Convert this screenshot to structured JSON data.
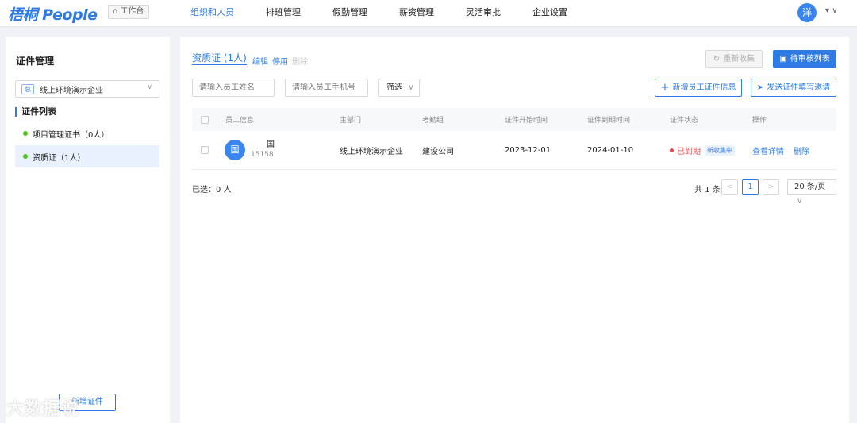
{
  "app": {
    "logo": "梧桐 People",
    "workbench": "工作台",
    "user_initial": "洋",
    "user_caret": "▾ ∨"
  },
  "nav": {
    "items": [
      {
        "label": "组织和人员",
        "active": true
      },
      {
        "label": "排班管理"
      },
      {
        "label": "假勤管理"
      },
      {
        "label": "薪资管理"
      },
      {
        "label": "灵活审批"
      },
      {
        "label": "企业设置"
      }
    ]
  },
  "sidebar": {
    "title": "证件管理",
    "company_tag": "总",
    "company": "线上环境演示企业",
    "section": "证件列表",
    "items": [
      {
        "label": "项目管理证书（0人）",
        "active": false
      },
      {
        "label": "资质证（1人）",
        "active": true
      }
    ],
    "bottom_button": "新增证件"
  },
  "main": {
    "title": "资质证 (1人)",
    "edit": "编辑",
    "disable": "停用",
    "delete": "删除",
    "refresh_button": "重新收集",
    "pending_button": "待审核列表",
    "name_placeholder": "请输入员工姓名",
    "phone_placeholder": "请输入员工手机号",
    "filter": "筛选",
    "add_button": "新增员工证件信息",
    "invite_button": "发送证件填写邀请"
  },
  "table": {
    "headers": [
      "员工信息",
      "主部门",
      "考勤组",
      "证件开始时间",
      "证件到期时间",
      "证件状态",
      "操作"
    ],
    "rows": [
      {
        "avatar": "国",
        "name": "国",
        "phone": "15158",
        "department": "线上环境演示企业",
        "group": "建设公司",
        "start": "2023-12-01",
        "end": "2024-01-10",
        "status": "已到期",
        "badge": "新收集中",
        "action_view": "查看详情",
        "action_delete": "删除"
      }
    ]
  },
  "footer": {
    "selected": "已选：0 人",
    "total": "共 1 条",
    "prev": "<",
    "page": "1",
    "next": ">",
    "page_size": "20 条/页"
  },
  "watermark": "大数据说"
}
